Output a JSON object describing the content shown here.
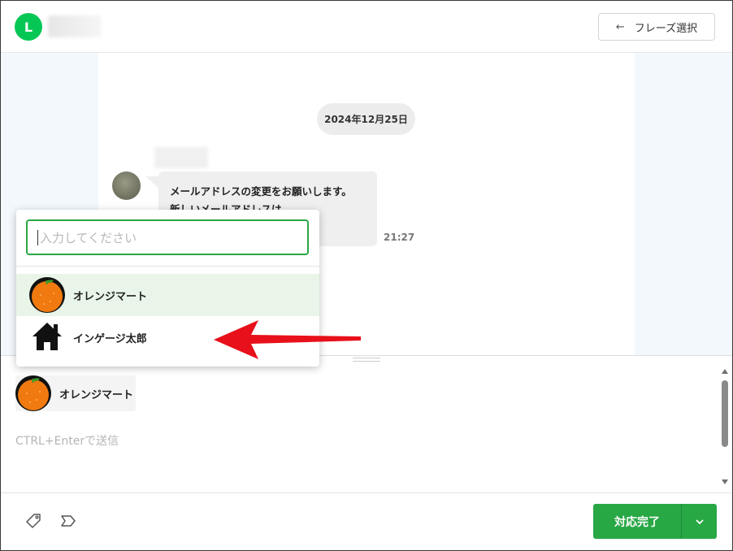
{
  "header": {
    "brand_initial": "L",
    "phrase_button_label": "フレーズ選択",
    "phrase_button_icon": "arrow-left-icon"
  },
  "chat": {
    "date_label": "2024年12月25日",
    "message_lines": [
      "メールアドレスの変更をお願いします。",
      "新しいメールアドレスは"
    ],
    "message_time": "21:27"
  },
  "popup": {
    "search_placeholder": "入力してください",
    "items": [
      {
        "label": "オレンジマート",
        "icon": "orange-icon",
        "active": true
      },
      {
        "label": "インゲージ太郎",
        "icon": "house-icon",
        "active": false
      }
    ]
  },
  "compose": {
    "selected_sender": "オレンジマート",
    "hint": "CTRL+Enterで送信"
  },
  "footer": {
    "done_label": "対応完了",
    "accent_color": "#28a745"
  },
  "colors": {
    "brand_green": "#06c755",
    "annotation_arrow": "#e8101a"
  }
}
